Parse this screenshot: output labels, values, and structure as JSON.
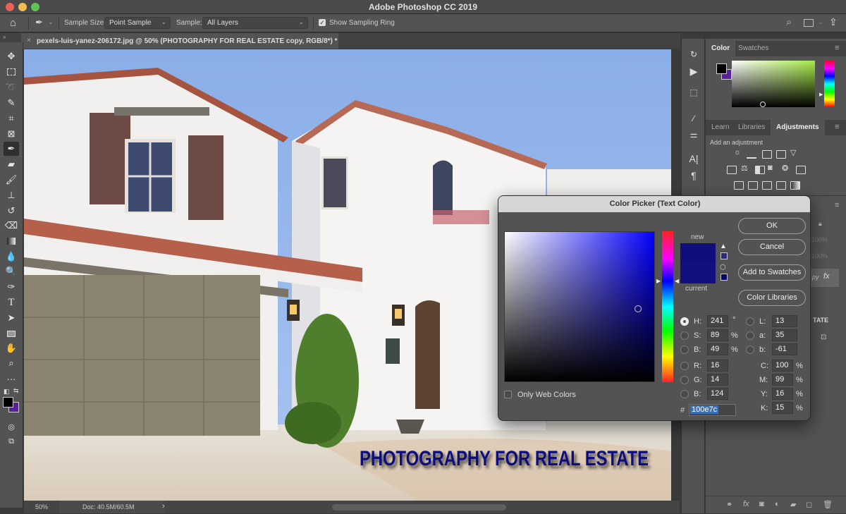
{
  "window": {
    "title": "Adobe Photoshop CC 2019"
  },
  "options_bar": {
    "sample_size_label": "Sample Size:",
    "sample_size_value": "Point Sample",
    "sample_label": "Sample:",
    "sample_value": "All Layers",
    "show_sampling_ring_label": "Show Sampling Ring",
    "show_sampling_ring_checked": true
  },
  "document_tab": {
    "title": "pexels-luis-yanez-206172.jpg @ 50% (PHOTOGRAPHY FOR REAL ESTATE copy, RGB/8*) *"
  },
  "canvas": {
    "overlay_text": "PHOTOGRAPHY FOR REAL ESTATE",
    "text_color": "#100e7c"
  },
  "status_bar": {
    "zoom": "50%",
    "doc_size": "Doc: 40.5M/60.5M",
    "arrow": "›"
  },
  "tools": [
    "move",
    "marquee",
    "lasso",
    "quick-select",
    "crop",
    "frame",
    "eyedropper",
    "healing",
    "brush",
    "stamp",
    "history-brush",
    "eraser",
    "gradient",
    "blur",
    "dodge",
    "pen",
    "type",
    "path-select",
    "rectangle",
    "hand",
    "zoom",
    "more"
  ],
  "toolbar_colors": {
    "foreground": "#000000",
    "background": "#5a1f9a"
  },
  "panels": {
    "color_tabs": [
      "Color",
      "Swatches"
    ],
    "adjust_tabs": [
      "Learn",
      "Libraries",
      "Adjustments"
    ],
    "add_adjustment_label": "Add an adjustment",
    "layers": {
      "opacity": "100%",
      "fill": "100%",
      "layer_name_partial": "py",
      "fx": "fx",
      "text_layer_partial": "TATE"
    }
  },
  "color_picker": {
    "title": "Color Picker (Text Color)",
    "new_label": "new",
    "current_label": "current",
    "new_color": "#100e7c",
    "current_color": "#120f7e",
    "buttons": {
      "ok": "OK",
      "cancel": "Cancel",
      "add_swatches": "Add to Swatches",
      "libraries": "Color Libraries"
    },
    "only_web_colors_label": "Only Web Colors",
    "only_web_colors_checked": false,
    "hsb": {
      "h_label": "H:",
      "h": "241",
      "h_unit": "°",
      "s_label": "S:",
      "s": "89",
      "s_unit": "%",
      "b_label": "B:",
      "b": "49",
      "b_unit": "%"
    },
    "rgb": {
      "r_label": "R:",
      "r": "16",
      "g_label": "G:",
      "g": "14",
      "b_label": "B:",
      "b": "124"
    },
    "lab": {
      "l_label": "L:",
      "l": "13",
      "a_label": "a:",
      "a": "35",
      "b_label": "b:",
      "b": "-61"
    },
    "cmyk": {
      "c_label": "C:",
      "c": "100",
      "m_label": "M:",
      "m": "99",
      "y_label": "Y:",
      "y": "16",
      "k_label": "K:",
      "k": "15",
      "unit": "%"
    },
    "hex_label": "#",
    "hex": "100e7c",
    "selected_mode": "H"
  }
}
